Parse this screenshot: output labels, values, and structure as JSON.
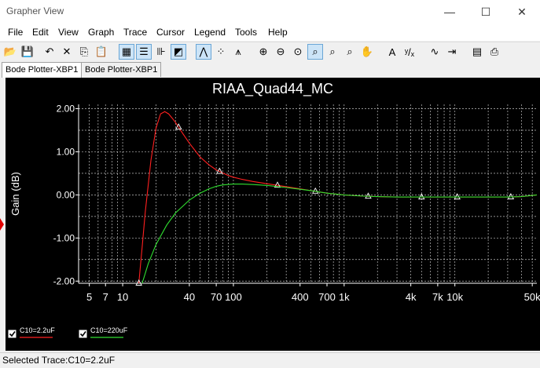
{
  "window": {
    "title": "Grapher View",
    "minimize": "—",
    "maximize": "☐",
    "close": "✕"
  },
  "menu": [
    "File",
    "Edit",
    "View",
    "Graph",
    "Trace",
    "Cursor",
    "Legend",
    "Tools",
    "Help"
  ],
  "toolbar": [
    {
      "name": "open-icon",
      "glyph": "📂"
    },
    {
      "name": "save-icon",
      "glyph": "💾"
    },
    {
      "name": "undo-icon",
      "glyph": "↶"
    },
    {
      "name": "delete-icon",
      "glyph": "✕"
    },
    {
      "name": "copy-icon",
      "glyph": "⎘"
    },
    {
      "name": "paste-icon",
      "glyph": "📋"
    },
    {
      "name": "grid-icon",
      "glyph": "▦",
      "pressed": true
    },
    {
      "name": "legend-icon",
      "glyph": "☰",
      "pressed": true
    },
    {
      "name": "cursor-toggle-icon",
      "glyph": "⊪"
    },
    {
      "name": "background-icon",
      "glyph": "◩",
      "pressed": true
    },
    {
      "name": "line-trace-icon",
      "glyph": "⋀",
      "pressed": true
    },
    {
      "name": "points-trace-icon",
      "glyph": "⁘"
    },
    {
      "name": "line-points-icon",
      "glyph": "⩚"
    },
    {
      "name": "zoom-in-icon",
      "glyph": "⊕"
    },
    {
      "name": "zoom-out-icon",
      "glyph": "⊖"
    },
    {
      "name": "zoom-full-icon",
      "glyph": "⊙"
    },
    {
      "name": "zoom-area-icon",
      "glyph": "⌕",
      "pressed": true
    },
    {
      "name": "zoom-x-icon",
      "glyph": "⌕"
    },
    {
      "name": "zoom-y-icon",
      "glyph": "⌕"
    },
    {
      "name": "pan-icon",
      "glyph": "✋"
    },
    {
      "name": "text-icon",
      "glyph": "A"
    },
    {
      "name": "cursor-label-icon",
      "glyph": "ʸ/ₓ"
    },
    {
      "name": "fft-icon",
      "glyph": "∿"
    },
    {
      "name": "export-icon",
      "glyph": "⇥"
    },
    {
      "name": "properties-icon",
      "glyph": "▤"
    },
    {
      "name": "print-icon",
      "glyph": "⎙"
    }
  ],
  "tabs": [
    "Bode Plotter-XBP1",
    "Bode Plotter-XBP1"
  ],
  "status": "Selected Trace:C10=2.2uF",
  "colors": {
    "plot_bg": "#000000",
    "trace1": "#ff2020",
    "trace2": "#30e030",
    "grid": "#ffffff",
    "text": "#ffffff"
  },
  "chart_data": {
    "type": "line",
    "title": "RIAA_Quad44_MC",
    "ylabel": "Gain (dB)",
    "xlabel": "",
    "xscale": "log",
    "xlim": [
      4,
      55000
    ],
    "ylim": [
      -2.05,
      2.1
    ],
    "xticks": [
      5,
      7,
      10,
      40,
      70,
      100,
      400,
      700,
      1000,
      4000,
      7000,
      10000,
      50000
    ],
    "xtick_labels": [
      "5",
      "7",
      "10",
      "40",
      "70",
      "100",
      "400",
      "700",
      "1k",
      "4k",
      "7k",
      "10k",
      "50k"
    ],
    "yticks": [
      2,
      1,
      0,
      -1,
      -2
    ],
    "ytick_labels": [
      "2.00",
      "1.00",
      "0.00",
      "-1.00",
      "-2.00"
    ],
    "grid": true,
    "legend": "bottom-left",
    "series": [
      {
        "name": "C10=2.2uF",
        "color": "#ff2020",
        "x": [
          14,
          15,
          16,
          18,
          20,
          22,
          24,
          26,
          28,
          30,
          35,
          40,
          50,
          60,
          70,
          80,
          90,
          100,
          120,
          150,
          200,
          300,
          400,
          500,
          700,
          1000,
          1500,
          2000,
          3000,
          4000,
          6000,
          10000,
          20000,
          30000,
          40000,
          55000
        ],
        "y": [
          -2.05,
          -1.2,
          -0.4,
          0.8,
          1.55,
          1.88,
          1.93,
          1.88,
          1.78,
          1.68,
          1.42,
          1.2,
          0.88,
          0.7,
          0.58,
          0.51,
          0.45,
          0.41,
          0.36,
          0.31,
          0.26,
          0.19,
          0.14,
          0.1,
          0.04,
          0.0,
          -0.03,
          -0.04,
          -0.05,
          -0.05,
          -0.05,
          -0.05,
          -0.05,
          -0.05,
          -0.04,
          0.0
        ],
        "markers_x": [
          14,
          32,
          75,
          250,
          550,
          1650,
          5000,
          10500,
          32000
        ]
      },
      {
        "name": "C10=220uF",
        "color": "#30e030",
        "x": [
          15,
          17,
          20,
          25,
          30,
          40,
          50,
          60,
          70,
          80,
          100,
          120,
          150,
          200,
          300,
          400,
          500,
          700,
          1000,
          1500,
          2000,
          3000,
          4000,
          6000,
          10000,
          20000,
          30000,
          40000,
          55000
        ],
        "y": [
          -2.05,
          -1.6,
          -1.15,
          -0.7,
          -0.42,
          -0.12,
          0.04,
          0.14,
          0.2,
          0.23,
          0.25,
          0.25,
          0.24,
          0.22,
          0.17,
          0.13,
          0.1,
          0.04,
          0.0,
          -0.03,
          -0.04,
          -0.05,
          -0.05,
          -0.05,
          -0.05,
          -0.05,
          -0.05,
          -0.04,
          0.0
        ],
        "markers_x": []
      }
    ]
  }
}
